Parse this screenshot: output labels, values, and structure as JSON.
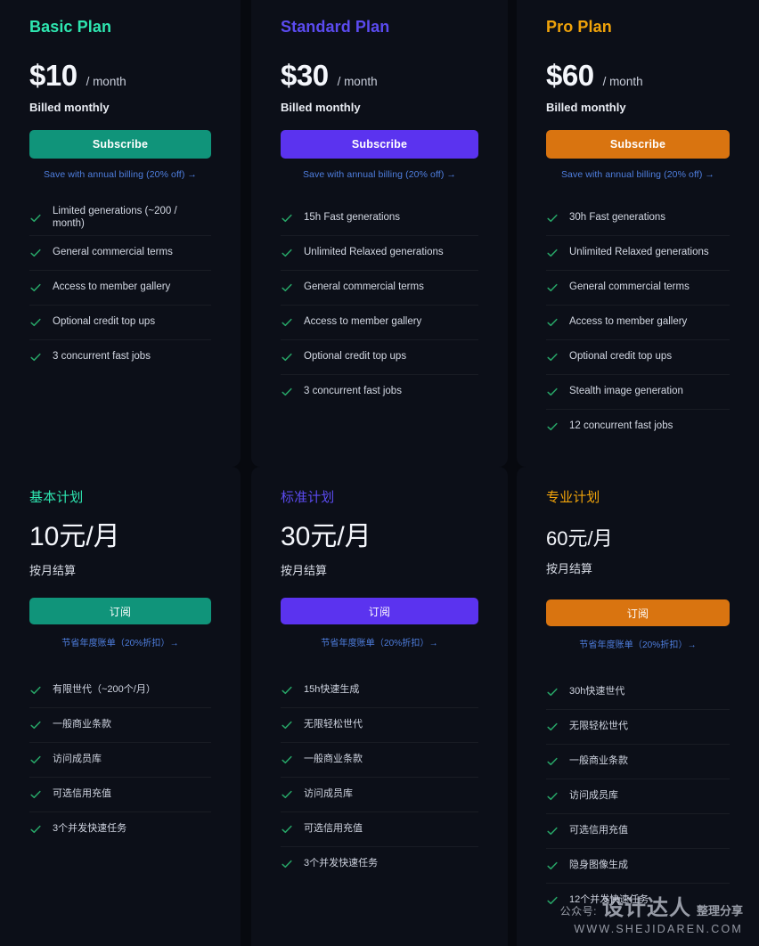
{
  "colors": {
    "page_bg": "#07090f",
    "card_bg": "#0c0f18",
    "basic_accent": "#2ee6b0",
    "standard_accent": "#5b4bf0",
    "pro_accent": "#f0a30a",
    "basic_button": "#10947a",
    "standard_button": "#5b33ef",
    "pro_button": "#d97410",
    "link": "#4f7fe0",
    "check": "#27a567",
    "text_primary": "#f4f6fb",
    "text_secondary": "#d4d9e4"
  },
  "plans_en": [
    {
      "title": "Basic Plan",
      "price": "$10",
      "per": "/ month",
      "billed": "Billed monthly",
      "button": "Subscribe",
      "save": "Save with annual billing (20% off) →",
      "features": [
        "Limited generations (~200 / month)",
        "General commercial terms",
        "Access to member gallery",
        "Optional credit top ups",
        "3 concurrent fast jobs"
      ]
    },
    {
      "title": "Standard Plan",
      "price": "$30",
      "per": "/ month",
      "billed": "Billed monthly",
      "button": "Subscribe",
      "save": "Save with annual billing (20% off) →",
      "features": [
        "15h Fast generations",
        "Unlimited Relaxed generations",
        "General commercial terms",
        "Access to member gallery",
        "Optional credit top ups",
        "3 concurrent fast jobs"
      ]
    },
    {
      "title": "Pro Plan",
      "price": "$60",
      "per": "/ month",
      "billed": "Billed monthly",
      "button": "Subscribe",
      "save": "Save with annual billing (20% off) →",
      "features": [
        "30h Fast generations",
        "Unlimited Relaxed generations",
        "General commercial terms",
        "Access to member gallery",
        "Optional credit top ups",
        "Stealth image generation",
        "12 concurrent fast jobs"
      ]
    }
  ],
  "plans_zh": [
    {
      "title": "基本计划",
      "price": "10元/月",
      "billed": "按月结算",
      "button": "订阅",
      "save": "节省年度账单（20%折扣）→",
      "features": [
        "有限世代（~200个/月）",
        "一般商业条款",
        "访问成员库",
        "可选信用充值",
        "3个并发快速任务"
      ]
    },
    {
      "title": "标准计划",
      "price": "30元/月",
      "billed": "按月结算",
      "button": "订阅",
      "save": "节省年度账单（20%折扣）→",
      "features": [
        "15h快速生成",
        "无限轻松世代",
        "一般商业条款",
        "访问成员库",
        "可选信用充值",
        "3个并发快速任务"
      ]
    },
    {
      "title": "专业计划",
      "price": "60元/月",
      "billed": "按月结算",
      "button": "订阅",
      "save": "节省年度账单（20%折扣）→",
      "features": [
        "30h快速世代",
        "无限轻松世代",
        "一般商业条款",
        "访问成员库",
        "可选信用充值",
        "隐身图像生成",
        "12个并发快速任务"
      ]
    }
  ],
  "watermark": {
    "prefix": "公众号:",
    "brand": "设计达人",
    "suffix": "整理分享",
    "url": "WWW.SHEJIDAREN.COM"
  }
}
